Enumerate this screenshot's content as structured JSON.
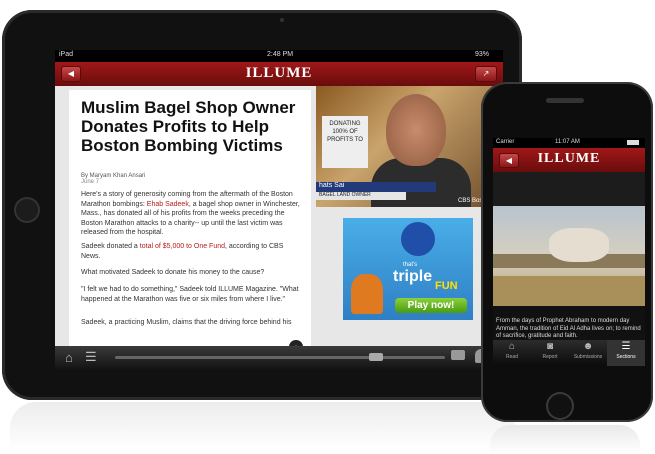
{
  "ipad": {
    "status": {
      "carrier": "iPad",
      "time": "2:48 PM",
      "battery": "93%"
    },
    "app_title": "ILLUME",
    "article": {
      "headline": "Muslim Bagel Shop Owner Donates Profits to Help Boston Bombing Victims",
      "byline": "By Maryam Khan Ansari",
      "date": "June 7",
      "p1_a": "Here's a story of generosity coming from the aftermath of the Boston Marathon bombings:",
      "p1_link": "Ehab Sadeek",
      "p1_b": ", a bagel shop owner in Winchester, Mass., has donated all of his profits from the weeks preceding the Boston Marathon attacks to a charity-- up until the last victim was released from the hospital.",
      "p2_a": "Sadeek donated a",
      "p2_link": "total of $5,000 to One Fund",
      "p2_b": ", according to CBS News.",
      "p3": "What motivated Sadeek to donate his money to the cause?",
      "p4": "\"I felt we had to do something,\" Sadeek told ILLUME Magazine. \"What happened at the Marathon was five or six miles from where I live.\"",
      "p5": "Sadeek, a practicing Muslim, claims that the driving force behind his"
    },
    "video": {
      "sign_text": "DONATING 100% OF PROFITS TO",
      "lower_third_1": "hats Sai",
      "lower_third_2": "BAGEL LAND OWNER",
      "network": "CBS Bos"
    },
    "ad": {
      "line1": "that's",
      "line2": "triple",
      "line3": "FUN",
      "cta": "Play now!"
    }
  },
  "iphone": {
    "status": {
      "carrier": "Carrier",
      "time": "11:07 AM"
    },
    "app_title": "ILLUME",
    "caption": "From the days of Prophet Abraham to modern day Amman, the tradition of Eid Al Adha lives on; to remind of sacrifice, gratitude and faith.",
    "tabs": [
      {
        "label": "Read",
        "icon": "home-icon"
      },
      {
        "label": "Report",
        "icon": "camera-icon"
      },
      {
        "label": "Submissions",
        "icon": "people-icon"
      },
      {
        "label": "Sections",
        "icon": "menu-icon"
      }
    ]
  }
}
